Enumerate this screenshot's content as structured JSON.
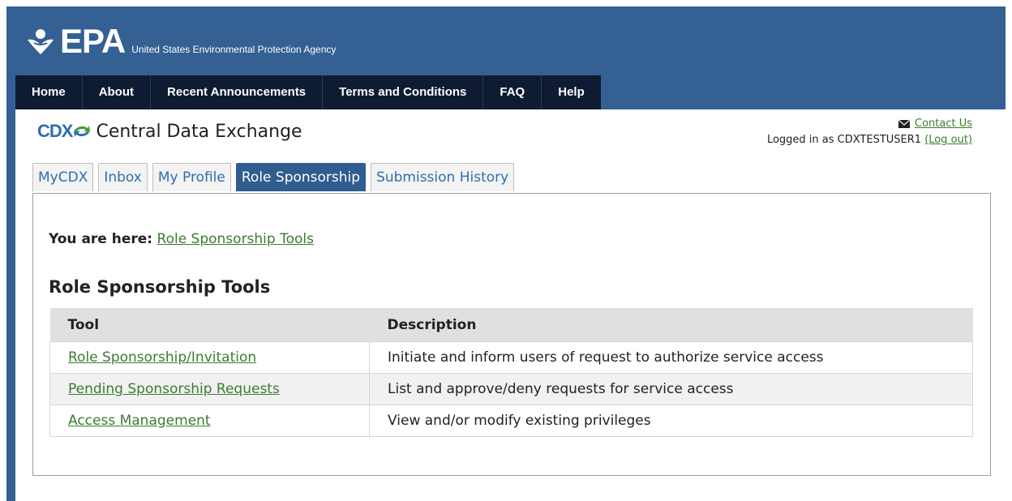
{
  "header": {
    "brand": "EPA",
    "agency": "United States Environmental Protection Agency"
  },
  "nav": {
    "items": [
      {
        "label": "Home"
      },
      {
        "label": "About"
      },
      {
        "label": "Recent Announcements"
      },
      {
        "label": "Terms and Conditions"
      },
      {
        "label": "FAQ"
      },
      {
        "label": "Help"
      }
    ]
  },
  "cdx": {
    "mark": "CDX",
    "title": "Central Data Exchange"
  },
  "account": {
    "contact_label": "Contact Us",
    "logged_in_prefix": "Logged in as CDXTESTUSER1",
    "logout_label": "(Log out)"
  },
  "tabs": [
    {
      "label": "MyCDX"
    },
    {
      "label": "Inbox"
    },
    {
      "label": "My Profile"
    },
    {
      "label": "Role Sponsorship"
    },
    {
      "label": "Submission History"
    }
  ],
  "breadcrumb": {
    "prefix": "You are here:",
    "link": "Role Sponsorship Tools"
  },
  "section": {
    "title": "Role Sponsorship Tools"
  },
  "table": {
    "headers": [
      "Tool",
      "Description"
    ],
    "rows": [
      {
        "tool": "Role Sponsorship/Invitation",
        "description": "Initiate and inform users of request to authorize service access"
      },
      {
        "tool": "Pending Sponsorship Requests",
        "description": "List and approve/deny requests for service access"
      },
      {
        "tool": "Access Management",
        "description": "View and/or modify existing privileges"
      }
    ]
  },
  "colors": {
    "header_blue": "#346094",
    "nav_dark": "#0e1b33",
    "link_green": "#3a7d2f",
    "active_tab": "#2f5d8f"
  },
  "icons": {
    "epa_logo": "epa-flower-icon",
    "cdx_arrows": "cdx-arrows-icon",
    "contact": "envelope-icon"
  }
}
